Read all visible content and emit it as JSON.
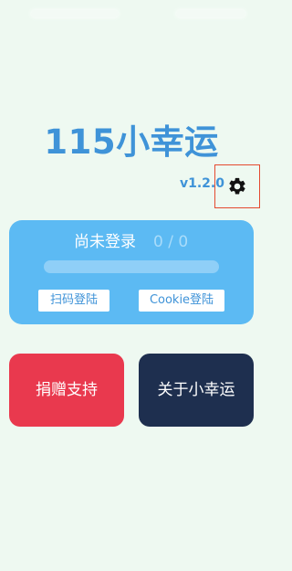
{
  "app": {
    "title": "115小幸运",
    "version": "v1.2.0"
  },
  "login": {
    "status": "尚未登录",
    "count": "0 / 0",
    "progress": 0
  },
  "buttons": {
    "scan_login": "扫码登陆",
    "cookie_login": "Cookie登陆",
    "donate": "捐赠支持",
    "about": "关于小幸运"
  },
  "icons": {
    "settings": "gear-icon"
  },
  "colors": {
    "background": "#eef9f1",
    "title": "#3f93d8",
    "login_card": "#5cbaf3",
    "donate": "#e9394e",
    "about": "#1e2f4f",
    "highlight_border": "#e44a2f"
  }
}
